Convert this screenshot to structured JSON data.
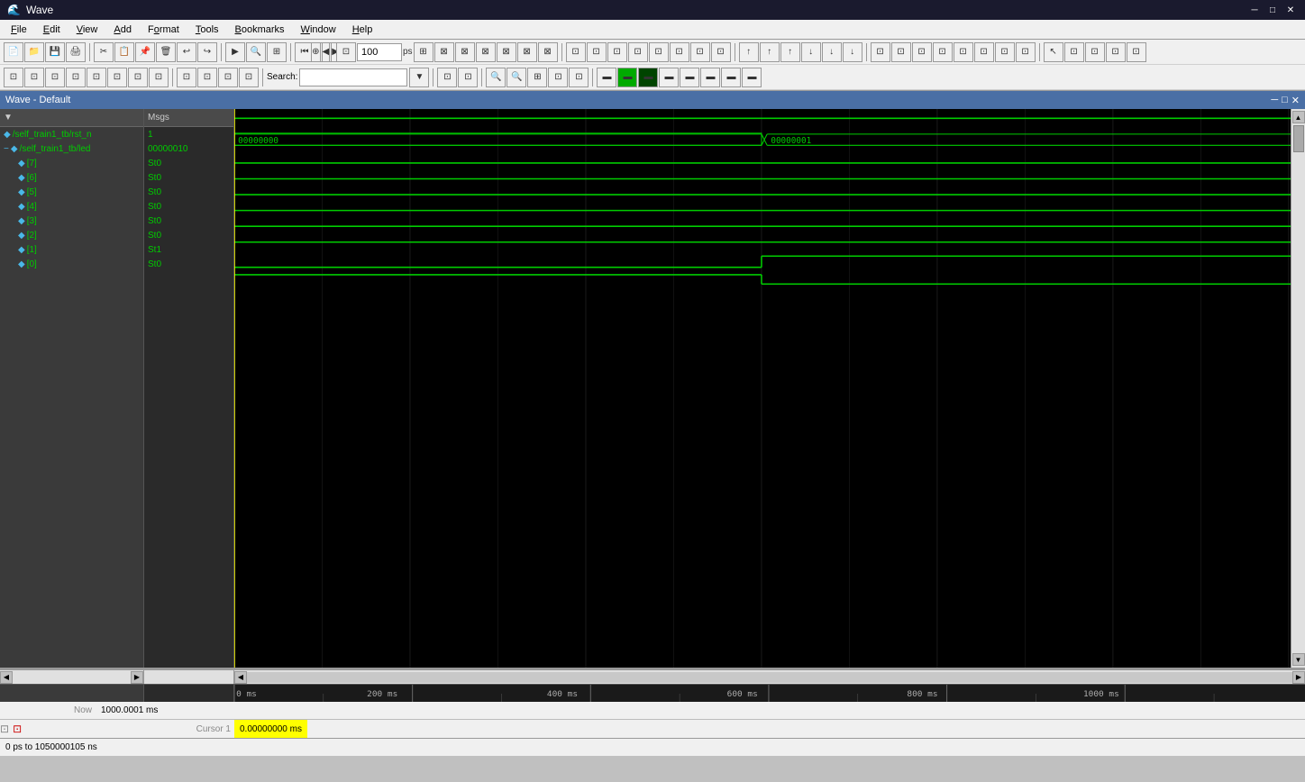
{
  "titleBar": {
    "icon": "🌊",
    "title": "Wave",
    "minimize": "─",
    "maximize": "□",
    "close": "✕"
  },
  "menuBar": {
    "items": [
      {
        "label": "File",
        "underline": "F"
      },
      {
        "label": "Edit",
        "underline": "E"
      },
      {
        "label": "View",
        "underline": "V"
      },
      {
        "label": "Add",
        "underline": "A"
      },
      {
        "label": "Format",
        "underline": "o"
      },
      {
        "label": "Tools",
        "underline": "T"
      },
      {
        "label": "Bookmarks",
        "underline": "B"
      },
      {
        "label": "Window",
        "underline": "W"
      },
      {
        "label": "Help",
        "underline": "H"
      }
    ]
  },
  "waveWindow": {
    "title": "Wave - Default"
  },
  "signals": [
    {
      "name": "/self_train1_tb/rst_n",
      "indent": 0,
      "type": "scalar",
      "expand": false
    },
    {
      "name": "/self_train1_tb/led",
      "indent": 0,
      "type": "bus",
      "expand": true
    },
    {
      "name": "[7]",
      "indent": 1,
      "type": "scalar"
    },
    {
      "name": "[6]",
      "indent": 1,
      "type": "scalar"
    },
    {
      "name": "[5]",
      "indent": 1,
      "type": "scalar"
    },
    {
      "name": "[4]",
      "indent": 1,
      "type": "scalar"
    },
    {
      "name": "[3]",
      "indent": 1,
      "type": "scalar"
    },
    {
      "name": "[2]",
      "indent": 1,
      "type": "scalar"
    },
    {
      "name": "[1]",
      "indent": 1,
      "type": "scalar"
    },
    {
      "name": "[0]",
      "indent": 1,
      "type": "scalar"
    }
  ],
  "values": [
    {
      "signal": "/self_train1_tb/rst_n",
      "value": "1"
    },
    {
      "signal": "/self_train1_tb/led",
      "value": "00000010"
    },
    {
      "signal": "[7]",
      "value": "St0"
    },
    {
      "signal": "[6]",
      "value": "St0"
    },
    {
      "signal": "[5]",
      "value": "St0"
    },
    {
      "signal": "[4]",
      "value": "St0"
    },
    {
      "signal": "[3]",
      "value": "St0"
    },
    {
      "signal": "[2]",
      "value": "St0"
    },
    {
      "signal": "[1]",
      "value": "St1"
    },
    {
      "signal": "[0]",
      "value": "St0"
    }
  ],
  "waveform": {
    "busLabel1": "00000000",
    "busLabel2": "00000001",
    "timeScale": "100 ps"
  },
  "statusBar": {
    "now": "1000.0001 ms",
    "cursor1Label": "Cursor 1",
    "cursor1Value": "0.00000000 ms",
    "timeRange": "0 ps to 1050000105 ns",
    "timeline": {
      "marks": [
        "0 ms",
        "200 ms",
        "400 ms",
        "600 ms",
        "800 ms",
        "1000 ms"
      ]
    }
  }
}
